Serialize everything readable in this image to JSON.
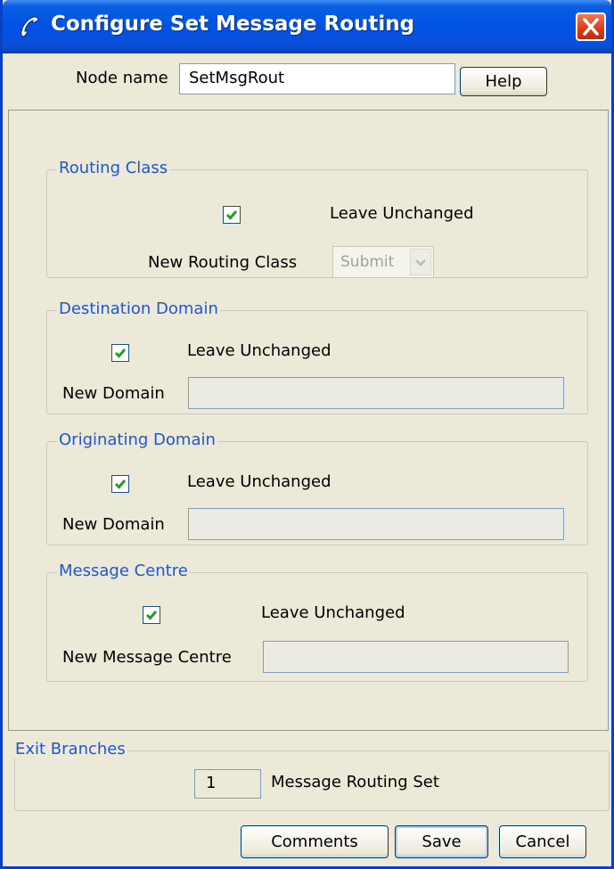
{
  "window": {
    "title": "Configure Set Message Routing",
    "title_icon": "phone-handset-icon",
    "close_icon": "close-icon"
  },
  "node": {
    "label": "Node name",
    "value": "SetMsgRout",
    "help_label": "Help"
  },
  "routing_class": {
    "title": "Routing Class",
    "leave_unchanged_label": "Leave Unchanged",
    "leave_unchanged_checked": true,
    "new_label": "New Routing Class",
    "new_value": "Submit",
    "enabled": false
  },
  "destination_domain": {
    "title": "Destination Domain",
    "leave_unchanged_label": "Leave Unchanged",
    "leave_unchanged_checked": true,
    "new_label": "New Domain",
    "new_value": ""
  },
  "originating_domain": {
    "title": "Originating Domain",
    "leave_unchanged_label": "Leave Unchanged",
    "leave_unchanged_checked": true,
    "new_label": "New Domain",
    "new_value": ""
  },
  "message_centre": {
    "title": "Message Centre",
    "leave_unchanged_label": "Leave Unchanged",
    "leave_unchanged_checked": true,
    "new_label": "New Message Centre",
    "new_value": ""
  },
  "exit_branches": {
    "title": "Exit Branches",
    "branch_number": "1",
    "branch_label": "Message Routing Set"
  },
  "buttons": {
    "comments": "Comments",
    "save": "Save",
    "cancel": "Cancel"
  },
  "colors": {
    "titlebar": "#0052e6",
    "group_title": "#1f56d0",
    "checkmark": "#21a121",
    "background": "#ece9d8"
  }
}
